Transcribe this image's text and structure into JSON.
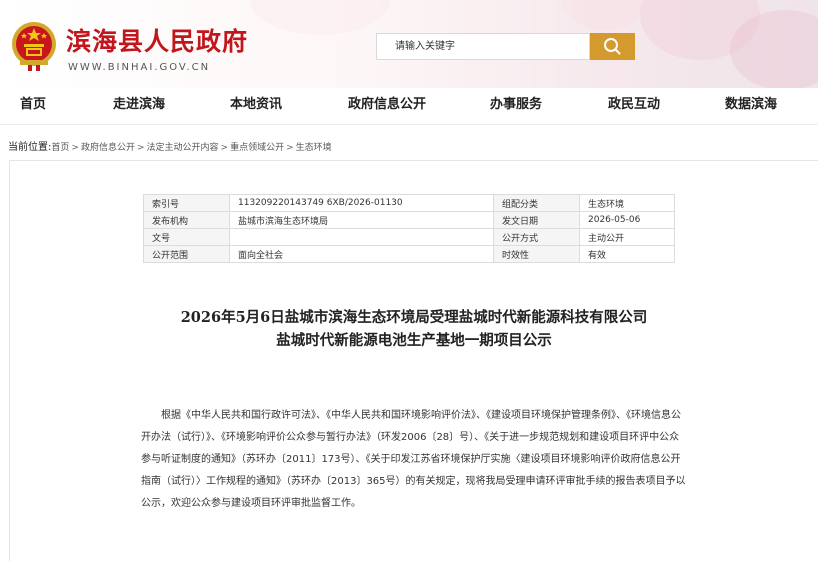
{
  "header": {
    "title": "滨海县人民政府",
    "domain": "WWW.BINHAI.GOV.CN",
    "search_placeholder": "请输入关键字"
  },
  "nav": [
    {
      "label": "首页"
    },
    {
      "label": "走进滨海"
    },
    {
      "label": "本地资讯"
    },
    {
      "label": "政府信息公开"
    },
    {
      "label": "办事服务"
    },
    {
      "label": "政民互动"
    },
    {
      "label": "数据滨海"
    }
  ],
  "breadcrumb": {
    "lead": "当前位置:",
    "items": [
      "首页",
      "政府信息公开",
      "法定主动公开内容",
      "重点领域公开",
      "生态环境"
    ],
    "sep": ">"
  },
  "meta": {
    "rows": [
      {
        "k1": "索引号",
        "v1": "113209220143749 6XB/2026-01130",
        "k2": "组配分类",
        "v2": "生态环境"
      },
      {
        "k1": "发布机构",
        "v1": "盐城市滨海生态环境局",
        "k2": "发文日期",
        "v2": "2026-05-06"
      },
      {
        "k1": "文号",
        "v1": "",
        "k2": "公开方式",
        "v2": "主动公开"
      },
      {
        "k1": "公开范围",
        "v1": "面向全社会",
        "k2": "时效性",
        "v2": "有效"
      }
    ]
  },
  "article": {
    "title_line1": "2026年5月6日盐城市滨海生态环境局受理盐城时代新能源科技有限公司",
    "title_line2": "盐城时代新能源电池生产基地一期项目公示",
    "body": "根据《中华人民共和国行政许可法》、《中华人民共和国环境影响评价法》、《建设项目环境保护管理条例》、《环境信息公开办法（试行）》、《环境影响评价公众参与暂行办法》（环发2006〔28〕号）、《关于进一步规范规划和建设项目环评中公众参与听证制度的通知》（苏环办〔2011〕173号）、《关于印发江苏省环境保护厅实施〈建设项目环境影响评价政府信息公开指南（试行）〉工作规程的通知》（苏环办〔2013〕365号）的有关规定，现将我局受理申请环评审批手续的报告表项目予以公示，欢迎公众参与建设项目环评审批监督工作。"
  }
}
